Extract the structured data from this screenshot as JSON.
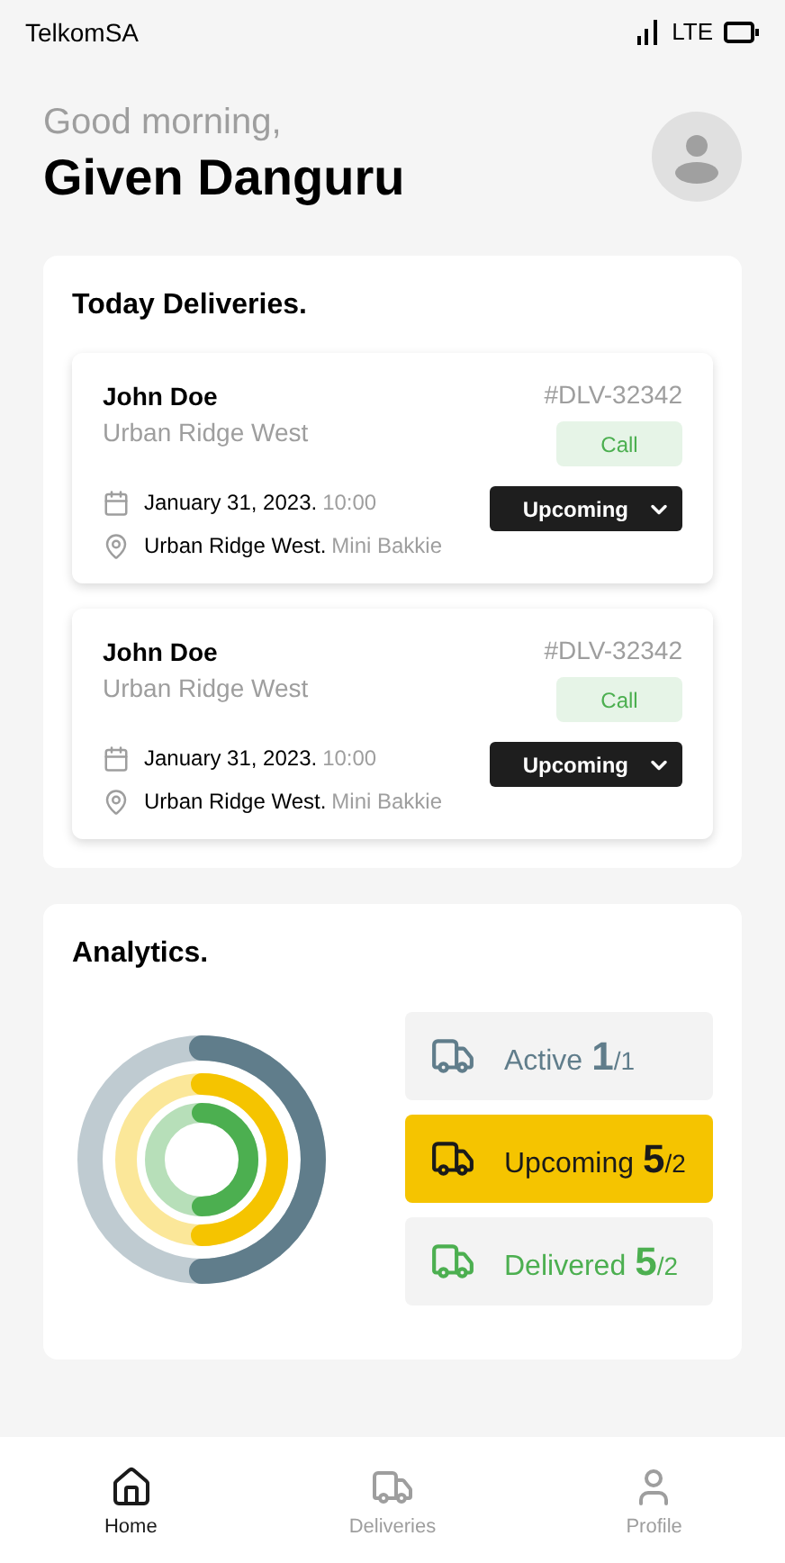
{
  "status_bar": {
    "carrier": "TelkomSA",
    "network": "LTE"
  },
  "greeting": {
    "salutation": "Good morning,",
    "name": "Given Danguru"
  },
  "deliveries": {
    "title": "Today Deliveries.",
    "items": [
      {
        "customer": "John Doe",
        "area": "Urban Ridge West",
        "id": "#DLV-32342",
        "call": "Call",
        "date": "January 31, 2023.",
        "time": "10:00",
        "place": "Urban Ridge West.",
        "vehicle": "Mini Bakkie",
        "status": "Upcoming"
      },
      {
        "customer": "John Doe",
        "area": "Urban Ridge West",
        "id": "#DLV-32342",
        "call": "Call",
        "date": "January 31, 2023.",
        "time": "10:00",
        "place": "Urban Ridge West.",
        "vehicle": "Mini Bakkie",
        "status": "Upcoming"
      }
    ]
  },
  "analytics": {
    "title": "Analytics.",
    "stats": [
      {
        "label": "Active",
        "count": "1",
        "total": "/1",
        "color": "#607d8b",
        "selected": false
      },
      {
        "label": "Upcoming",
        "count": "5",
        "total": "/2",
        "color": "#f5c400",
        "selected": true
      },
      {
        "label": "Delivered",
        "count": "5",
        "total": "/2",
        "color": "#4caf50",
        "selected": false
      }
    ]
  },
  "nav": [
    {
      "label": "Home",
      "kind": "home",
      "selected": true
    },
    {
      "label": "Deliveries",
      "kind": "truck",
      "selected": false
    },
    {
      "label": "Profile",
      "kind": "user",
      "selected": false
    }
  ]
}
